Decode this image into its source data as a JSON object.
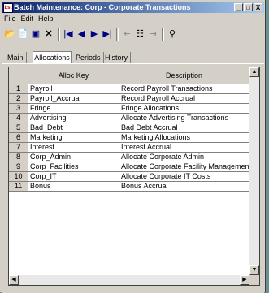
{
  "window": {
    "title": "Batch Maintenance: Corp - Corporate Transactions",
    "icon_text": "bst",
    "minimize": "_",
    "maximize": "□",
    "close": "X"
  },
  "menu": [
    "File",
    "Edit",
    "Help"
  ],
  "toolbar": {
    "buttons": [
      "open-icon",
      "new-icon",
      "save-icon",
      "delete-icon",
      "first-record-icon",
      "previous-record-icon",
      "next-record-icon",
      "last-record-icon",
      "insert-row-icon",
      "grid-icon",
      "append-row-icon",
      "search-icon"
    ]
  },
  "tabs": [
    "Main",
    "Allocations",
    "Periods",
    "History"
  ],
  "active_tab": "Allocations",
  "grid": {
    "columns": [
      "Alloc Key",
      "Description"
    ],
    "rows": [
      {
        "num": "1",
        "key": "Payroll",
        "desc": "Record Payroll Transactions"
      },
      {
        "num": "2",
        "key": "Payroll_Accrual",
        "desc": "Record Payroll Accrual"
      },
      {
        "num": "3",
        "key": "Fringe",
        "desc": "Fringe Allocations"
      },
      {
        "num": "4",
        "key": "Advertising",
        "desc": "Allocate Advertising Transactions"
      },
      {
        "num": "5",
        "key": "Bad_Debt",
        "desc": "Bad Debt Accrual"
      },
      {
        "num": "6",
        "key": "Marketing",
        "desc": "Marketing Allocations"
      },
      {
        "num": "7",
        "key": "Interest",
        "desc": "Interest Accrual"
      },
      {
        "num": "8",
        "key": "Corp_Admin",
        "desc": "Allocate Corporate Admin"
      },
      {
        "num": "9",
        "key": "Corp_Facilities",
        "desc": "Allocate Corporate Facility Management"
      },
      {
        "num": "10",
        "key": "Corp_IT",
        "desc": "Allocate Corporate IT Costs"
      },
      {
        "num": "11",
        "key": "Bonus",
        "desc": "Bonus Accrual"
      }
    ]
  }
}
